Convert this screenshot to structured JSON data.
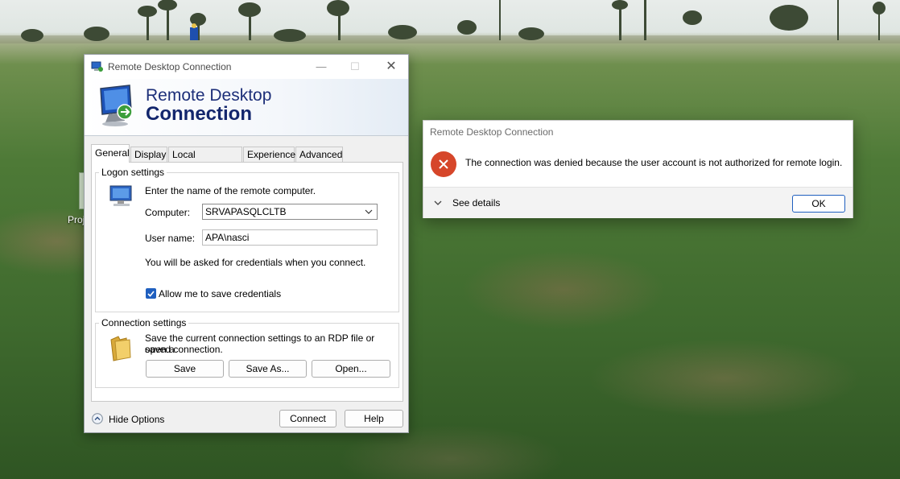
{
  "desktop": {
    "icon_label": "Proj"
  },
  "rdc_window": {
    "title": "Remote Desktop Connection",
    "banner_line1": "Remote Desktop",
    "banner_line2": "Connection",
    "tabs": [
      {
        "label": "General"
      },
      {
        "label": "Display"
      },
      {
        "label": "Local Resources"
      },
      {
        "label": "Experience"
      },
      {
        "label": "Advanced"
      }
    ],
    "logon": {
      "group_label": "Logon settings",
      "instruction": "Enter the name of the remote computer.",
      "computer_label": "Computer:",
      "computer_value": "SRVAPASQLCLTB",
      "username_label": "User name:",
      "username_value": "APA\\nasci",
      "credentials_note": "You will be asked for credentials when you connect.",
      "save_credentials_label": "Allow me to save credentials",
      "save_credentials_checked": true
    },
    "connection": {
      "group_label": "Connection settings",
      "description_line1": "Save the current connection settings to an RDP file or open a",
      "description_line2": "saved connection.",
      "save_label": "Save",
      "save_as_label": "Save As...",
      "open_label": "Open..."
    },
    "footer": {
      "hide_options_label": "Hide Options",
      "connect_label": "Connect",
      "help_label": "Help"
    }
  },
  "error_dialog": {
    "title": "Remote Desktop Connection",
    "message": "The connection was denied because the user account is not authorized for remote login.",
    "see_details_label": "See details",
    "ok_label": "OK",
    "icon": "error-x-icon",
    "icon_color": "#d6462a"
  }
}
